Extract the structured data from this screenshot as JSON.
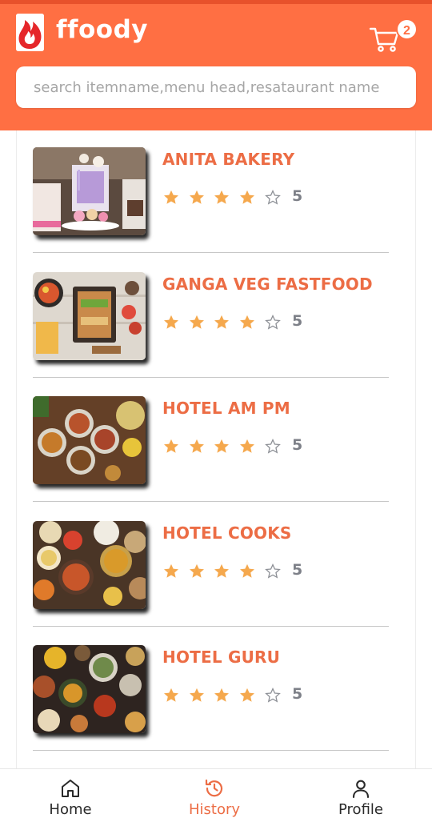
{
  "app": {
    "name": "ffoody"
  },
  "header": {
    "cart_count": "2"
  },
  "search": {
    "placeholder": "search itemname,menu head,resataurant name"
  },
  "colors": {
    "brand": "#ff6f43",
    "accent_text": "#ec6d45",
    "star": "#f5a84d"
  },
  "restaurants": [
    {
      "name": "ANITA BAKERY",
      "stars_filled": 4,
      "stars_total": 5,
      "rating": "5",
      "image": "cake-photo"
    },
    {
      "name": "GANGA VEG FASTFOOD",
      "stars_filled": 4,
      "stars_total": 5,
      "rating": "5",
      "image": "fastfood-platter-photo"
    },
    {
      "name": "HOTEL AM PM",
      "stars_filled": 4,
      "stars_total": 5,
      "rating": "5",
      "image": "curry-bowls-photo"
    },
    {
      "name": "HOTEL COOKS",
      "stars_filled": 4,
      "stars_total": 5,
      "rating": "5",
      "image": "indian-thali-photo"
    },
    {
      "name": "HOTEL GURU",
      "stars_filled": 4,
      "stars_total": 5,
      "rating": "5",
      "image": "food-spread-photo"
    }
  ],
  "bottom_nav": [
    {
      "label": "Home",
      "icon": "home-icon",
      "active": false
    },
    {
      "label": "History",
      "icon": "history-icon",
      "active": true
    },
    {
      "label": "Profile",
      "icon": "profile-icon",
      "active": false
    }
  ]
}
